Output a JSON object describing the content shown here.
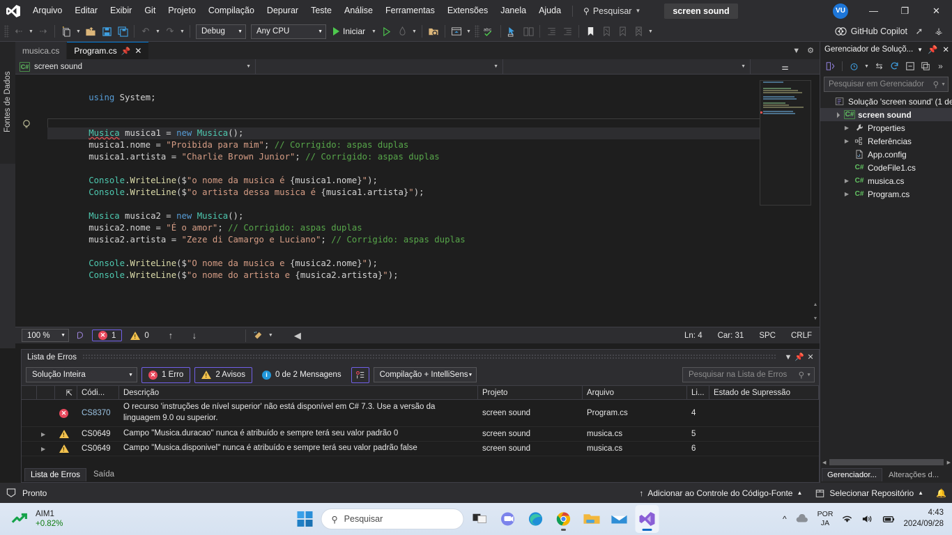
{
  "titlebar": {
    "menus": [
      "Arquivo",
      "Editar",
      "Exibir",
      "Git",
      "Projeto",
      "Compilação",
      "Depurar",
      "Teste",
      "Análise",
      "Ferramentas",
      "Extensões",
      "Janela",
      "Ajuda"
    ],
    "search_label": "Pesquisar",
    "project_chip": "screen sound",
    "avatar_initials": "VU",
    "minimize": "—",
    "restore": "❐",
    "close": "✕"
  },
  "toolbar": {
    "config_value": "Debug",
    "platform_value": "Any CPU",
    "start_label": "Iniciar",
    "copilot_label": "GitHub Copilot"
  },
  "sidebar_left": {
    "label": "Fontes de Dados"
  },
  "editor": {
    "tabs": [
      {
        "label": "musica.cs",
        "active": false
      },
      {
        "label": "Program.cs",
        "active": true
      }
    ],
    "nav_project": "screen sound",
    "nav_type": "",
    "nav_member": "",
    "cs_badge": "C#",
    "code_lines": [
      {
        "indent": 0,
        "segs": []
      },
      {
        "indent": 2,
        "segs": [
          {
            "t": "using ",
            "c": "kw"
          },
          {
            "t": "System",
            "c": "pl"
          },
          {
            "t": ";",
            "c": "pl"
          }
        ]
      },
      {
        "indent": 0,
        "segs": []
      },
      {
        "indent": 0,
        "segs": []
      },
      {
        "indent": 2,
        "current": true,
        "segs": [
          {
            "t": "Musica",
            "c": "type squig"
          },
          {
            "t": " ",
            "c": "pl"
          },
          {
            "t": "musica1",
            "c": "pl"
          },
          {
            "t": " = ",
            "c": "pl"
          },
          {
            "t": "new",
            "c": "kw"
          },
          {
            "t": " ",
            "c": "pl"
          },
          {
            "t": "Musica",
            "c": "type"
          },
          {
            "t": "();",
            "c": "pl"
          }
        ]
      },
      {
        "indent": 2,
        "segs": [
          {
            "t": "musica1",
            "c": "pl"
          },
          {
            "t": ".nome = ",
            "c": "pl"
          },
          {
            "t": "\"Proibida para mim\"",
            "c": "str"
          },
          {
            "t": "; ",
            "c": "pl"
          },
          {
            "t": "// Corrigido: aspas duplas",
            "c": "com"
          }
        ]
      },
      {
        "indent": 2,
        "segs": [
          {
            "t": "musica1",
            "c": "pl"
          },
          {
            "t": ".artista = ",
            "c": "pl"
          },
          {
            "t": "\"Charlie Brown Junior\"",
            "c": "str"
          },
          {
            "t": "; ",
            "c": "pl"
          },
          {
            "t": "// Corrigido: aspas duplas",
            "c": "com"
          }
        ]
      },
      {
        "indent": 0,
        "segs": []
      },
      {
        "indent": 2,
        "segs": [
          {
            "t": "Console",
            "c": "type"
          },
          {
            "t": ".",
            "c": "pl"
          },
          {
            "t": "WriteLine",
            "c": "mth"
          },
          {
            "t": "($",
            "c": "pl"
          },
          {
            "t": "\"o nome da musica é ",
            "c": "str"
          },
          {
            "t": "{",
            "c": "pl"
          },
          {
            "t": "musica1",
            "c": "pl"
          },
          {
            "t": ".nome",
            "c": "pl"
          },
          {
            "t": "}",
            "c": "pl"
          },
          {
            "t": "\"",
            "c": "str"
          },
          {
            "t": ");",
            "c": "pl"
          }
        ]
      },
      {
        "indent": 2,
        "segs": [
          {
            "t": "Console",
            "c": "type"
          },
          {
            "t": ".",
            "c": "pl"
          },
          {
            "t": "WriteLine",
            "c": "mth"
          },
          {
            "t": "($",
            "c": "pl"
          },
          {
            "t": "\"o artista dessa musica é ",
            "c": "str"
          },
          {
            "t": "{",
            "c": "pl"
          },
          {
            "t": "musica1",
            "c": "pl"
          },
          {
            "t": ".artista",
            "c": "pl"
          },
          {
            "t": "}",
            "c": "pl"
          },
          {
            "t": "\"",
            "c": "str"
          },
          {
            "t": ");",
            "c": "pl"
          }
        ]
      },
      {
        "indent": 0,
        "segs": []
      },
      {
        "indent": 2,
        "segs": [
          {
            "t": "Musica",
            "c": "type"
          },
          {
            "t": " musica2 = ",
            "c": "pl"
          },
          {
            "t": "new",
            "c": "kw"
          },
          {
            "t": " ",
            "c": "pl"
          },
          {
            "t": "Musica",
            "c": "type"
          },
          {
            "t": "();",
            "c": "pl"
          }
        ]
      },
      {
        "indent": 2,
        "segs": [
          {
            "t": "musica2",
            "c": "pl"
          },
          {
            "t": ".nome = ",
            "c": "pl"
          },
          {
            "t": "\"É o amor\"",
            "c": "str"
          },
          {
            "t": "; ",
            "c": "pl"
          },
          {
            "t": "// Corrigido: aspas duplas",
            "c": "com"
          }
        ]
      },
      {
        "indent": 2,
        "segs": [
          {
            "t": "musica2",
            "c": "pl"
          },
          {
            "t": ".artista = ",
            "c": "pl"
          },
          {
            "t": "\"Zeze di Camargo e Luciano\"",
            "c": "str"
          },
          {
            "t": "; ",
            "c": "pl"
          },
          {
            "t": "// Corrigido: aspas duplas",
            "c": "com"
          }
        ]
      },
      {
        "indent": 0,
        "segs": []
      },
      {
        "indent": 2,
        "segs": [
          {
            "t": "Console",
            "c": "type"
          },
          {
            "t": ".",
            "c": "pl"
          },
          {
            "t": "WriteLine",
            "c": "mth"
          },
          {
            "t": "($",
            "c": "pl"
          },
          {
            "t": "\"O nome da musica e ",
            "c": "str"
          },
          {
            "t": "{",
            "c": "pl"
          },
          {
            "t": "musica2",
            "c": "pl"
          },
          {
            "t": ".nome",
            "c": "pl"
          },
          {
            "t": "}",
            "c": "pl"
          },
          {
            "t": "\"",
            "c": "str"
          },
          {
            "t": ");",
            "c": "pl"
          }
        ]
      },
      {
        "indent": 2,
        "segs": [
          {
            "t": "Console",
            "c": "type"
          },
          {
            "t": ".",
            "c": "pl"
          },
          {
            "t": "WriteLine",
            "c": "mth"
          },
          {
            "t": "($",
            "c": "pl"
          },
          {
            "t": "\"o nome do artista e ",
            "c": "str"
          },
          {
            "t": "{",
            "c": "pl"
          },
          {
            "t": "musica2",
            "c": "pl"
          },
          {
            "t": ".artista",
            "c": "pl"
          },
          {
            "t": "}",
            "c": "pl"
          },
          {
            "t": "\"",
            "c": "str"
          },
          {
            "t": ");",
            "c": "pl"
          }
        ]
      }
    ],
    "status": {
      "zoom": "100 %",
      "error_count": "1",
      "warning_count": "0",
      "line": "Ln: 4",
      "col": "Car: 31",
      "spaces": "SPC",
      "eol": "CRLF"
    }
  },
  "error_panel": {
    "title": "Lista de Erros",
    "scope_value": "Solução Inteira",
    "errors_label": "1 Erro",
    "warnings_label": "2 Avisos",
    "messages_label": "0 de 2 Mensagens",
    "build_filter_value": "Compilação + IntelliSens",
    "search_placeholder": "Pesquisar na Lista de Erros",
    "columns": [
      "Códi...",
      "Descrição",
      "Projeto",
      "Arquivo",
      "Li...",
      "Estado de Supressão"
    ],
    "rows": [
      {
        "severity": "error",
        "code": "CS8370",
        "description": "O recurso 'instruções de nível superior' não está disponível em C# 7.3. Use a versão da linguagem 9.0 ou superior.",
        "project": "screen sound",
        "file": "Program.cs",
        "line": "4",
        "suppression": ""
      },
      {
        "severity": "warning",
        "code": "CS0649",
        "description": "Campo \"Musica.duracao\" nunca é atribuído e sempre terá seu valor padrão 0",
        "project": "screen sound",
        "file": "musica.cs",
        "line": "5",
        "suppression": ""
      },
      {
        "severity": "warning",
        "code": "CS0649",
        "description": "Campo \"Musica.disponivel\" nunca é atribuído e sempre terá seu valor padrão false",
        "project": "screen sound",
        "file": "musica.cs",
        "line": "6",
        "suppression": ""
      }
    ],
    "tabs": [
      {
        "label": "Lista de Erros",
        "active": true
      },
      {
        "label": "Saída",
        "active": false
      }
    ]
  },
  "solution_explorer": {
    "title": "Gerenciador de Soluçõ...",
    "search_placeholder": "Pesquisar em Gerenciador",
    "tree": [
      {
        "level": 0,
        "label": "Solução 'screen sound' (1 de",
        "icon": "solution-icon",
        "twisty": "",
        "selected": false
      },
      {
        "level": 1,
        "label": "screen sound",
        "icon": "csharp-project-icon",
        "twisty": "▲",
        "selected": true,
        "bold": true
      },
      {
        "level": 2,
        "label": "Properties",
        "icon": "wrench-icon",
        "twisty": "▶",
        "selected": false
      },
      {
        "level": 2,
        "label": "Referências",
        "icon": "references-icon",
        "twisty": "▶",
        "selected": false
      },
      {
        "level": 2,
        "label": "App.config",
        "icon": "config-file-icon",
        "twisty": "",
        "selected": false
      },
      {
        "level": 2,
        "label": "CodeFile1.cs",
        "icon": "csharp-file-icon",
        "twisty": "",
        "selected": false
      },
      {
        "level": 2,
        "label": "musica.cs",
        "icon": "csharp-file-icon",
        "twisty": "▶",
        "selected": false
      },
      {
        "level": 2,
        "label": "Program.cs",
        "icon": "csharp-file-icon",
        "twisty": "▶",
        "selected": false
      }
    ],
    "tabs": [
      {
        "label": "Gerenciador...",
        "active": true
      },
      {
        "label": "Alterações d...",
        "active": false
      }
    ]
  },
  "vs_status": {
    "ready": "Pronto",
    "source_control": "Adicionar ao Controle do Código-Fonte",
    "repository": "Selecionar Repositório"
  },
  "taskbar": {
    "widget_name": "AIM1",
    "widget_change": "+0.82%",
    "search_placeholder": "Pesquisar",
    "tray_lang_1": "POR",
    "tray_lang_2": "JA",
    "time": "4:43",
    "date": "2024/09/28"
  },
  "colors": {
    "accent": "#0078d4",
    "error": "#e8485c",
    "warning": "#f2c14e",
    "info": "#2196d9",
    "purple_border": "#7160e8",
    "chrome": "#2d2d30",
    "editor_bg": "#1e1e1e"
  }
}
